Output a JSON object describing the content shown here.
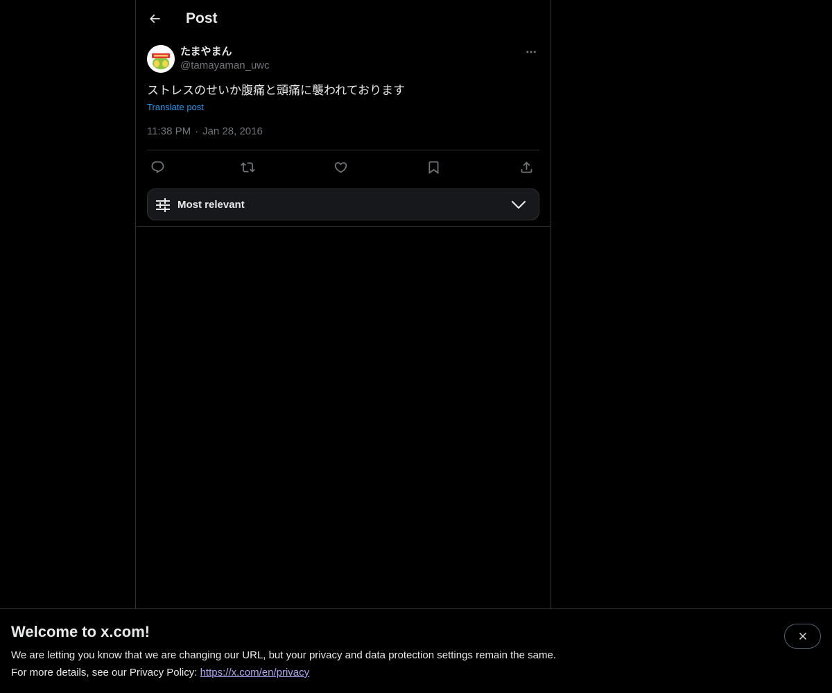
{
  "header": {
    "title": "Post",
    "back_icon": "arrow-left-icon"
  },
  "post": {
    "author": {
      "display_name": "たまやまん",
      "handle": "@tamayaman_uwc",
      "avatar_icon": "avatar-image"
    },
    "more_icon": "ellipsis-icon",
    "text": "ストレスのせいか腹痛と頭痛に襲われております",
    "translate_label": "Translate post",
    "time": "11:38 PM",
    "separator": "·",
    "date": "Jan 28, 2016",
    "actions": [
      {
        "name": "reply",
        "icon": "reply-icon"
      },
      {
        "name": "repost",
        "icon": "repost-icon"
      },
      {
        "name": "like",
        "icon": "heart-icon"
      },
      {
        "name": "bookmark",
        "icon": "bookmark-icon"
      },
      {
        "name": "share",
        "icon": "share-icon"
      }
    ]
  },
  "sort": {
    "label": "Most relevant",
    "icon": "sliders-icon",
    "dropdown_icon": "chevron-down-icon"
  },
  "banner": {
    "title": "Welcome to x.com!",
    "line1": "We are letting you know that we are changing our URL, but your privacy and data protection settings remain the same.",
    "line2_prefix": "For more details, see our Privacy Policy: ",
    "link_text": "https://x.com/en/privacy",
    "close_icon": "close-icon"
  },
  "colors": {
    "background": "#000000",
    "text_primary": "#e7e9ea",
    "text_secondary": "#71767b",
    "accent": "#1d9bf0",
    "border": "#2f3336",
    "link": "#a8a6f5"
  }
}
